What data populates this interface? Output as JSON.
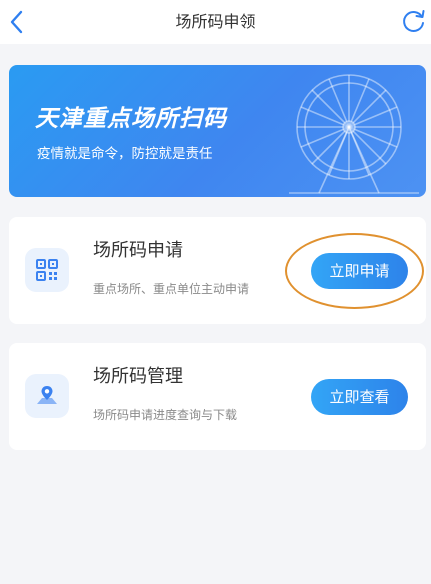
{
  "header": {
    "title": "场所码申领",
    "back_icon": "chevron-left-icon",
    "refresh_icon": "refresh-icon"
  },
  "banner": {
    "title": "天津重点场所扫码",
    "subtitle": "疫情就是命令，防控就是责任",
    "illustration": "ferris-wheel"
  },
  "cards": [
    {
      "title": "场所码申请",
      "subtitle": "重点场所、重点单位主动申请",
      "button": "立即申请",
      "icon": "qr-code-icon"
    },
    {
      "title": "场所码管理",
      "subtitle": "场所码申请进度查询与下载",
      "button": "立即查看",
      "icon": "map-pin-icon"
    }
  ],
  "colors": {
    "accent": "#2d8cf0",
    "highlight_circle": "#e0912f",
    "background": "#f4f5f8"
  }
}
